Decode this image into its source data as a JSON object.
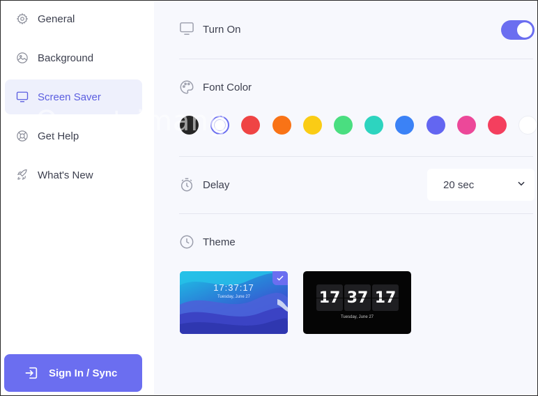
{
  "sidebar": {
    "items": [
      {
        "label": "General",
        "icon": "gear-icon",
        "active": false
      },
      {
        "label": "Background",
        "icon": "image-icon",
        "active": false
      },
      {
        "label": "Screen Saver",
        "icon": "monitor-icon",
        "active": true
      },
      {
        "label": "Get Help",
        "icon": "lifebuoy-icon",
        "active": false
      },
      {
        "label": "What's New",
        "icon": "rocket-icon",
        "active": false
      }
    ],
    "signin_label": "Sign In / Sync"
  },
  "settings": {
    "turn_on": {
      "label": "Turn On",
      "enabled": true
    },
    "font_color": {
      "label": "Font Color",
      "swatches": [
        "#262626",
        "#ffffff",
        "#ef4444",
        "#f97316",
        "#facc15",
        "#4ade80",
        "#2dd4bf",
        "#3b82f6",
        "#6366f1",
        "#ec4899",
        "#f43f5e",
        "#ffffff"
      ],
      "selected_index": 1
    },
    "delay": {
      "label": "Delay",
      "value": "20 sec"
    },
    "theme": {
      "label": "Theme",
      "themes": [
        {
          "name": "waves",
          "time": "17:37:17",
          "date": "Tuesday, June 27",
          "selected": true
        },
        {
          "name": "flip-clock",
          "digits": [
            "17",
            "37",
            "17"
          ],
          "date": "Tuesday, June 27",
          "selected": false
        }
      ]
    }
  },
  "watermark": "Quantrimang",
  "colors": {
    "accent": "#6b6ef0",
    "active_bg": "#eef0fc",
    "main_bg": "#f7f8fd"
  }
}
